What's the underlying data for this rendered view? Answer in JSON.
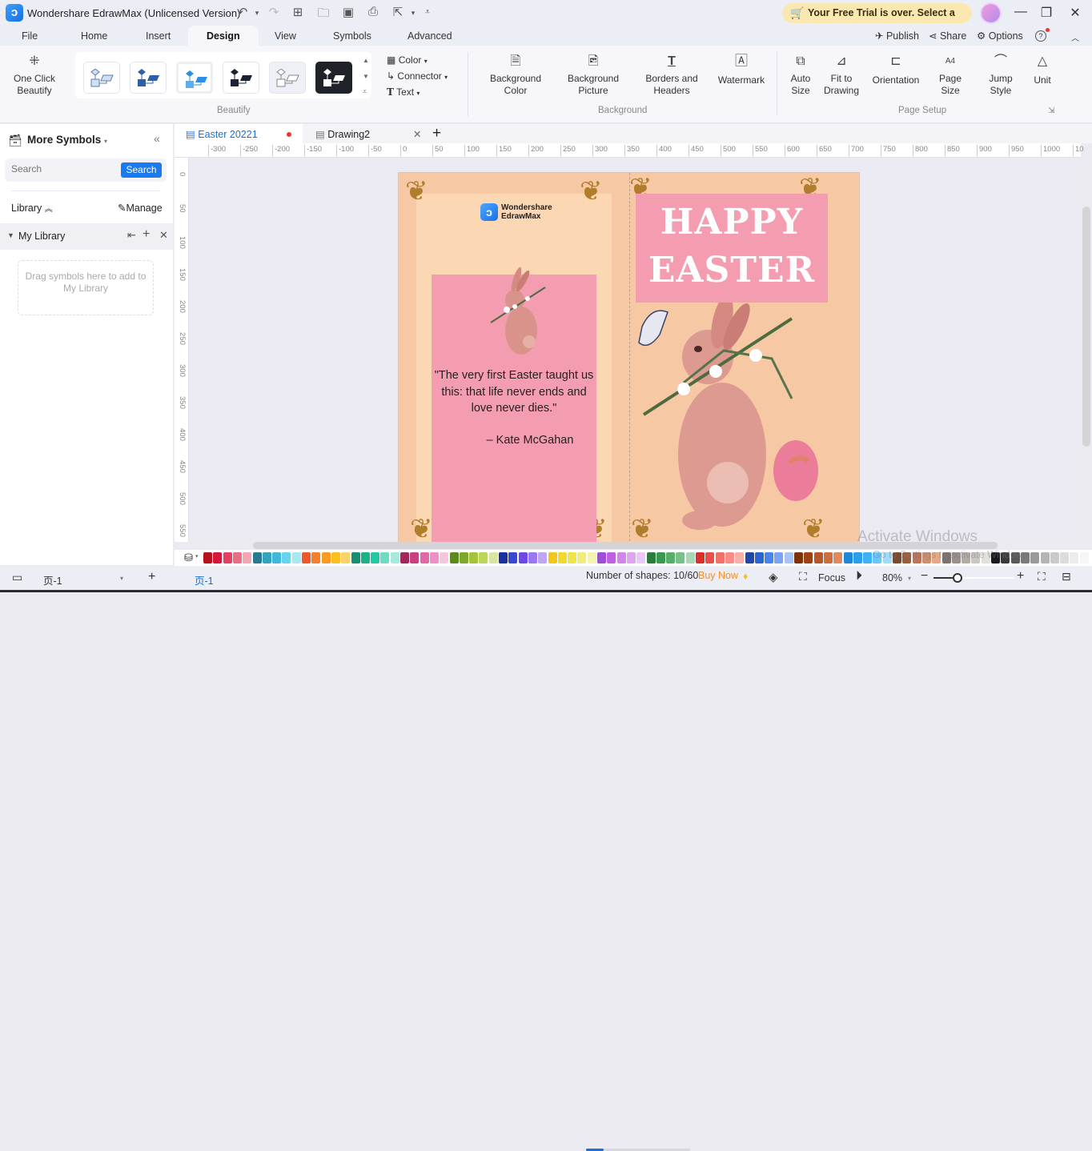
{
  "titlebar": {
    "app_title": "Wondershare EdrawMax (Unlicensed Version)",
    "trial_banner": "Your Free Trial is over. Select a Plan",
    "quick_access": [
      "undo-icon",
      "redo-icon",
      "new-icon",
      "open-icon",
      "save-icon",
      "print-icon",
      "export-icon",
      "customize-icon"
    ]
  },
  "menu": {
    "tabs": [
      "File",
      "Home",
      "Insert",
      "Design",
      "View",
      "Symbols",
      "Advanced"
    ],
    "active_tab": "Design",
    "right": {
      "publish": "Publish",
      "share": "Share",
      "options": "Options",
      "help": "?"
    }
  },
  "ribbon": {
    "one_click_beautify": "One Click Beautify",
    "beautify_group": "Beautify",
    "style_options": [
      "Color",
      "Connector",
      "Text"
    ],
    "background_group": "Background",
    "background_buttons": [
      "Background Color",
      "Background Picture",
      "Borders and Headers",
      "Watermark"
    ],
    "page_setup_group": "Page Setup",
    "page_setup_buttons": [
      "Auto Size",
      "Fit to Drawing",
      "Orientation",
      "Page Size",
      "Jump Style",
      "Unit"
    ]
  },
  "left_panel": {
    "title": "More Symbols",
    "search_placeholder": "Search",
    "search_button": "Search",
    "library_label": "Library",
    "manage_label": "Manage",
    "my_library": "My Library",
    "drag_hint": "Drag symbols here to add to My Library"
  },
  "doc_tabs": [
    {
      "label": "Easter 20221",
      "active": true,
      "unsaved": true
    },
    {
      "label": "Drawing2",
      "active": false,
      "unsaved": false
    }
  ],
  "rulers": {
    "horizontal": [
      "-300",
      "-250",
      "-200",
      "-150",
      "-100",
      "-50",
      "0",
      "50",
      "100",
      "150",
      "200",
      "250",
      "300",
      "350",
      "400",
      "450",
      "500",
      "550",
      "600",
      "650",
      "700",
      "750",
      "800",
      "850",
      "900",
      "950",
      "1000",
      "10"
    ],
    "vertical": [
      "0",
      "50",
      "100",
      "150",
      "200",
      "250",
      "300",
      "350",
      "400",
      "450",
      "500",
      "550"
    ]
  },
  "card": {
    "brand_line1": "Wondershare",
    "brand_line2": "EdrawMax",
    "quote": "\"The very first Easter taught us this: that life never ends and love never dies.\"",
    "author": "– Kate McGahan",
    "headline1": "HAPPY",
    "headline2": "EASTER",
    "colors": {
      "background": "#f6c9a4",
      "inner": "#fcd7b4",
      "pink": "#f59db0",
      "ornament": "#b07d2c"
    }
  },
  "palette": {
    "colors": [
      "#b5121b",
      "#d6173a",
      "#e4405f",
      "#ec6b85",
      "#f4a6b5",
      "#2a7a8f",
      "#35a3bd",
      "#41b7d9",
      "#67d3ec",
      "#a7e8f5",
      "#f0582a",
      "#f57f2b",
      "#f99b23",
      "#fbbf24",
      "#fcd36a",
      "#178f72",
      "#1cb38a",
      "#22c9a5",
      "#6edbc3",
      "#a6eadb",
      "#a1265a",
      "#c8417f",
      "#e06aa5",
      "#f08fc3",
      "#f5c6de",
      "#5c8a1f",
      "#7ea82d",
      "#a3c43a",
      "#bcd65c",
      "#d6e5a0",
      "#1c2f9e",
      "#3848d0",
      "#6a4ae0",
      "#9a78ee",
      "#bfa6f5",
      "#f5c518",
      "#f3d830",
      "#eee54a",
      "#f1ec7c",
      "#f6f3b0",
      "#9e4fd1",
      "#c05fe0",
      "#d584ec",
      "#dda4f0",
      "#e8c8f6",
      "#2c7a3c",
      "#3a9850",
      "#58ad6c",
      "#78c08a",
      "#a6d9b3",
      "#d8322c",
      "#ea4f4b",
      "#f0706a",
      "#f48e87",
      "#f7b0a8",
      "#1f48a6",
      "#2b63d0",
      "#4a84ee",
      "#7aa3f2",
      "#a8c3f5",
      "#7d3307",
      "#9c4213",
      "#b8582a",
      "#cf6c40",
      "#e08a60",
      "#1e88d8",
      "#2b9ee8",
      "#3fb0f0",
      "#6cc6f5",
      "#a0dcf8",
      "#7a4a2e",
      "#9a5e3e",
      "#b9765a",
      "#d18e6c",
      "#e6a882",
      "#7c746c",
      "#999189",
      "#b3aca4",
      "#cdc7c0",
      "#e3dfd9",
      "#1a1a1a",
      "#3a3a3a",
      "#5a5a5a",
      "#7a7a7a",
      "#9a9a9a",
      "#b4b4b4",
      "#cacaca",
      "#dcdcdc",
      "#ececec",
      "#f6f6f6"
    ]
  },
  "status": {
    "page_selector": "页-1",
    "page_tab": "页-1",
    "shapes_count": "Number of shapes: 10/60",
    "shapes_progress": 0.1667,
    "buy_now": "Buy Now",
    "focus": "Focus",
    "zoom": "80%",
    "zoom_slider_value": 0.3
  },
  "os_watermark": {
    "line1": "Activate Windows",
    "line2": "Go to Settings to activate Windows."
  }
}
